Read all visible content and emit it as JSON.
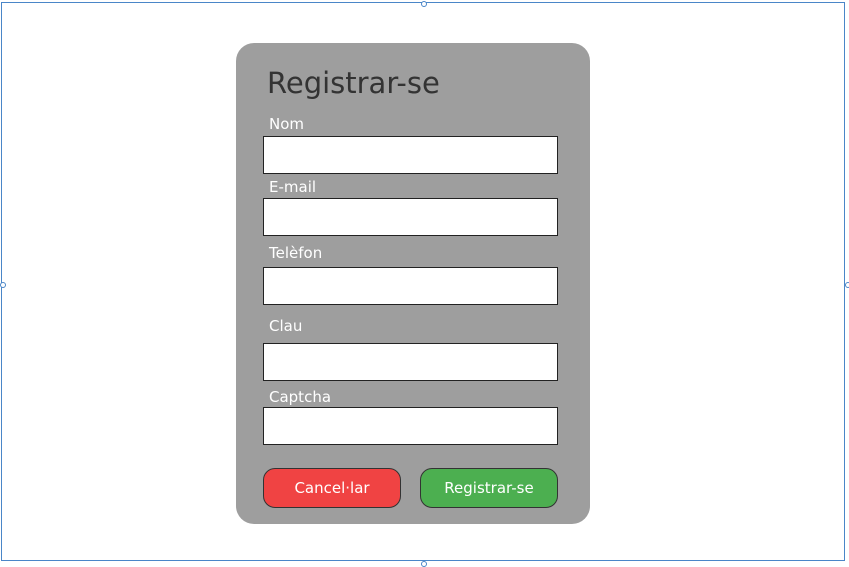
{
  "form": {
    "title": "Registrar-se",
    "fields": [
      {
        "label": "Nom",
        "value": "",
        "placeholder": ""
      },
      {
        "label": "E-mail",
        "value": "",
        "placeholder": ""
      },
      {
        "label": "Telèfon",
        "value": "",
        "placeholder": ""
      },
      {
        "label": "Clau",
        "value": "",
        "placeholder": ""
      },
      {
        "label": "Captcha",
        "value": "",
        "placeholder": ""
      }
    ],
    "cancel_label": "Cancel·lar",
    "submit_label": "Registrar-se"
  },
  "colors": {
    "panel_bg": "#9e9e9e",
    "cancel": "#f04343",
    "submit": "#4caf50",
    "title": "#333333",
    "selection": "#4a86c8"
  }
}
